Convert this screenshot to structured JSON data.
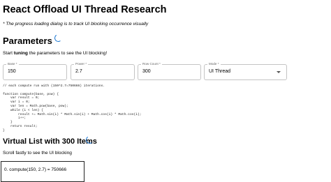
{
  "header": {
    "title": "React Offload UI Thread Research",
    "note": "* The progress loading dialog is to track UI blocking occurrence visually"
  },
  "parameters": {
    "heading": "Parameters",
    "intro_prefix": "Start ",
    "intro_bold": "tuning",
    "intro_suffix": " the parameters to see the UI blocking!",
    "base": {
      "label": "Base *",
      "value": "150"
    },
    "power": {
      "label": "Power *",
      "value": "2.7"
    },
    "row_count": {
      "label": "Row Count *",
      "value": "300"
    },
    "mode": {
      "label": "Mode *",
      "value": "UI Thread"
    }
  },
  "code": {
    "comment": "// each compute run with (150^2.7=750666) iterations.",
    "lines": [
      "",
      "function compute(base, pow) {",
      "    var result = 0;",
      "    var i = 0;",
      "    var len = Math.pow(base, pow);",
      "    while (i < len) {",
      "        result += Math.sin(i) * Math.sin(i) + Math.cos(i) * Math.cos(i);",
      "        i++;",
      "    }",
      "    return result;",
      "}"
    ]
  },
  "virtual_list": {
    "heading": "Virtual List with 300 Items",
    "subtitle": "Scroll fastly to see the UI blocking",
    "rows": [
      "0. compute(150, 2.7) = 750666"
    ]
  },
  "colors": {
    "spinner": "#1976d2",
    "field_border": "#c4c4c4"
  }
}
